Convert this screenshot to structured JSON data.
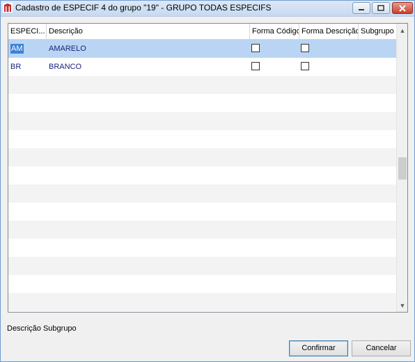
{
  "window": {
    "title": "Cadastro de ESPECIF 4 do grupo \"19\" - GRUPO TODAS ESPECIFS"
  },
  "grid": {
    "columns": [
      "ESPECI...",
      "Descrição",
      "Forma Código",
      "Forma Descrição",
      "Subgrupo"
    ],
    "rows": [
      {
        "code": "AM",
        "description": "AMARELO",
        "forma_codigo": false,
        "forma_descricao": false,
        "subgrupo": "",
        "selected": true
      },
      {
        "code": "BR",
        "description": "BRANCO",
        "forma_codigo": false,
        "forma_descricao": false,
        "subgrupo": "",
        "selected": false
      }
    ]
  },
  "footer": {
    "subgroup_label": "Descrição Subgrupo",
    "confirm_label": "Confirmar",
    "cancel_label": "Cancelar"
  },
  "colors": {
    "selected_row": "#b9d5f3",
    "grid_text": "#1a237e",
    "alt_row": "#f3f3f3"
  }
}
